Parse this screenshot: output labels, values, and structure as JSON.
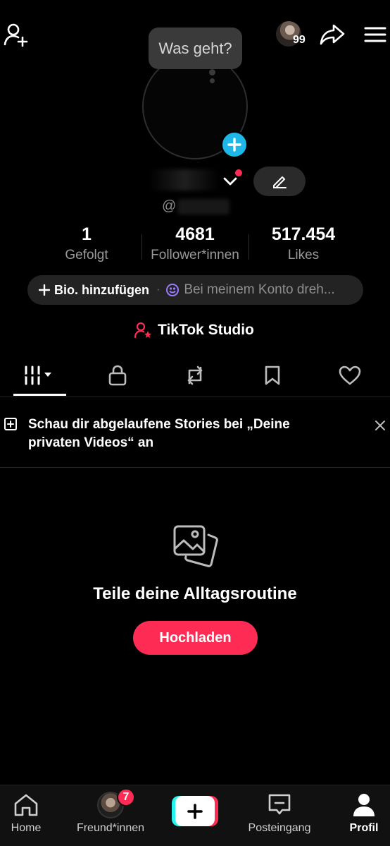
{
  "header": {
    "add_friend_icon": "add-user-icon",
    "notifications_count": "99",
    "share_icon": "share-icon",
    "menu_icon": "hamburger-menu-icon"
  },
  "profile": {
    "status_bubble": "Was geht?",
    "handle_prefix": "@",
    "edit_icon": "pencil-icon"
  },
  "stats": [
    {
      "value": "1",
      "label": "Gefolgt"
    },
    {
      "value": "4681",
      "label": "Follower*innen"
    },
    {
      "value": "517.454",
      "label": "Likes"
    }
  ],
  "bio": {
    "add_label": "Bio. hinzufügen",
    "rotating_text": "Bei meinem Konto dreh..."
  },
  "studio": {
    "label": "TikTok Studio"
  },
  "tabs": [
    {
      "name": "videos",
      "icon": "grid-icon",
      "active": true
    },
    {
      "name": "private",
      "icon": "lock-icon",
      "active": false
    },
    {
      "name": "reposts",
      "icon": "repost-icon",
      "active": false
    },
    {
      "name": "saved",
      "icon": "bookmark-icon",
      "active": false
    },
    {
      "name": "liked",
      "icon": "heart-icon",
      "active": false
    }
  ],
  "notice": {
    "text": "Schau dir abgelaufene Stories bei „Deine privaten Videos“ an"
  },
  "empty_state": {
    "title": "Teile deine Alltagsroutine",
    "button": "Hochladen"
  },
  "bottom_nav": {
    "home": "Home",
    "friends": "Freund*innen",
    "friends_badge": "7",
    "inbox": "Posteingang",
    "profile": "Profil"
  },
  "colors": {
    "accent": "#fe2c55",
    "cyan": "#25f4ee",
    "plus_badge": "#1fb7e8"
  }
}
